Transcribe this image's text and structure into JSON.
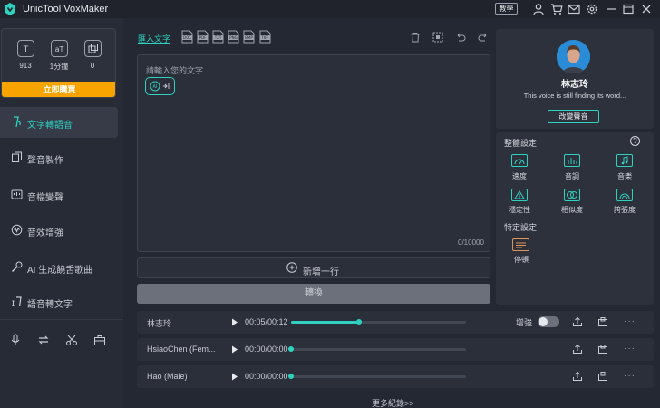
{
  "titlebar": {
    "title": "UnicTool VoxMaker",
    "teach_label": "教學"
  },
  "stats": {
    "items": [
      {
        "icon": "t-icon",
        "value": "913"
      },
      {
        "icon": "t-box-icon",
        "value": "1分鐘"
      },
      {
        "icon": "clone-icon",
        "value": "0"
      }
    ],
    "upgrade_label": "立即購買"
  },
  "nav": {
    "items": [
      {
        "label": "文字轉語音",
        "icon": "tts-icon",
        "active": true
      },
      {
        "label": "聲音製作",
        "icon": "voice-make-icon",
        "active": false
      },
      {
        "label": "音檔變聲",
        "icon": "voice-change-icon",
        "active": false
      },
      {
        "label": "音效增強",
        "icon": "enhance-icon",
        "active": false
      },
      {
        "label": "AI 生成饒舌歌曲",
        "icon": "rap-icon",
        "active": false
      },
      {
        "label": "語音轉文字",
        "icon": "stt-icon",
        "active": false
      }
    ]
  },
  "editor": {
    "import_label": "匯入文字",
    "file_types": [
      "DOC",
      "PDF",
      "TXT",
      "PNG",
      "BMP",
      "TIFF"
    ],
    "placeholder": "請輸入您的文字",
    "chip_label": "AI",
    "char_count": "0/10000",
    "add_line_label": "新增一行",
    "convert_label": "轉換"
  },
  "voice": {
    "name": "林志玲",
    "description": "This voice is still finding its word...",
    "change_label": "改變聲音"
  },
  "settings": {
    "title": "整體設定",
    "items": [
      {
        "label": "速度",
        "icon": "speed-icon"
      },
      {
        "label": "音調",
        "icon": "pitch-icon"
      },
      {
        "label": "音樂",
        "icon": "music-icon"
      },
      {
        "label": "穩定性",
        "icon": "stability-icon"
      },
      {
        "label": "相似度",
        "icon": "similarity-icon"
      },
      {
        "label": "誇張度",
        "icon": "exaggeration-icon"
      }
    ],
    "specific_title": "特定設定",
    "pause_label": "停頓"
  },
  "history": {
    "rows": [
      {
        "name": "林志玲",
        "time": "00:05/00:12",
        "progress": 0.39,
        "enhance": true
      },
      {
        "name": "HsiaoChen (Fem...",
        "time": "00:00/00:00",
        "progress": 0.0,
        "enhance": false
      },
      {
        "name": "Hao (Male)",
        "time": "00:00/00:00",
        "progress": 0.0,
        "enhance": false
      }
    ],
    "enhance_label": "增強",
    "more_label": "更多紀錄>>"
  },
  "colors": {
    "accent": "#2fd1c0",
    "upgrade": "#f7a400",
    "background": "#242833"
  }
}
